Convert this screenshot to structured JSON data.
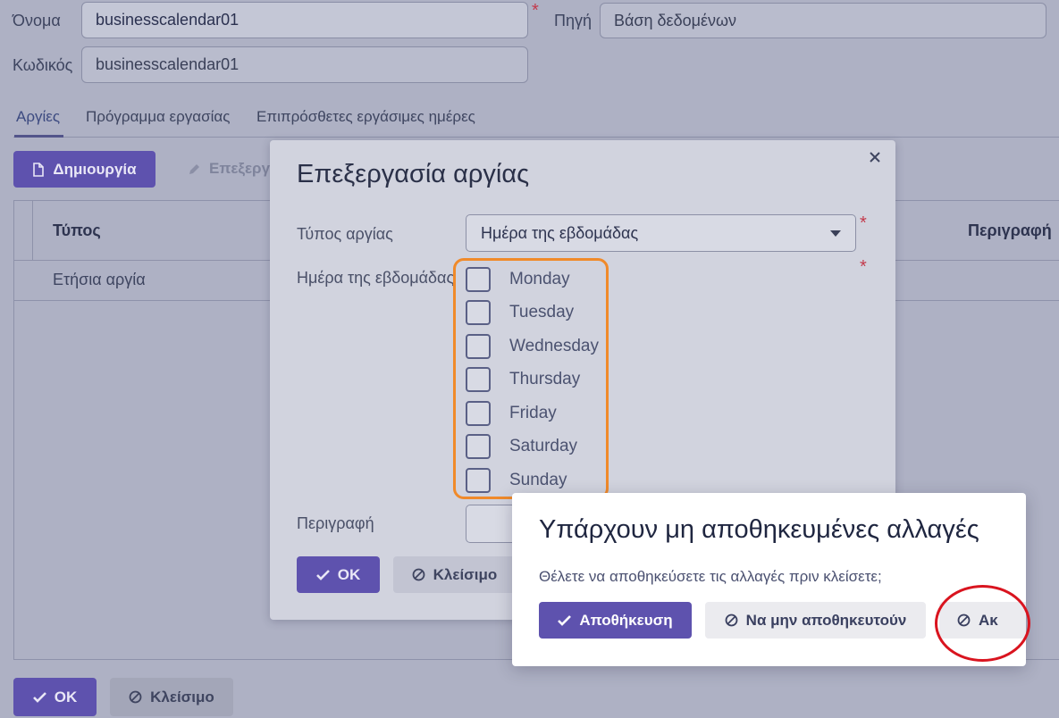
{
  "form": {
    "name_label": "Όνομα",
    "name_value": "businesscalendar01",
    "source_label": "Πηγή",
    "source_value": "Βάση δεδομένων",
    "code_label": "Κωδικός",
    "code_value": "businesscalendar01",
    "required_mark": "*"
  },
  "tabs": [
    {
      "label": "Αργίες"
    },
    {
      "label": "Πρόγραμμα εργασίας"
    },
    {
      "label": "Επιπρόσθετες εργάσιμες ημέρες"
    }
  ],
  "toolbar": {
    "create_label": "Δημιουργία",
    "edit_label": "Επεξεργ"
  },
  "table": {
    "col_type": "Τύπος",
    "col_description": "Περιγραφή",
    "rows": [
      {
        "type": "Ετήσια αργία"
      }
    ]
  },
  "footer": {
    "ok_label": "OK",
    "close_label": "Κλείσιμο"
  },
  "dialog": {
    "title": "Επεξεργασία αργίας",
    "holiday_type_label": "Τύπος αργίας",
    "holiday_type_value": "Ημέρα της εβδομάδας",
    "weekday_label": "Ημέρα της εβδομάδας",
    "weekdays": [
      {
        "label": "Monday",
        "checked": false
      },
      {
        "label": "Tuesday",
        "checked": false
      },
      {
        "label": "Wednesday",
        "checked": false
      },
      {
        "label": "Thursday",
        "checked": false
      },
      {
        "label": "Friday",
        "checked": false
      },
      {
        "label": "Saturday",
        "checked": false
      },
      {
        "label": "Sunday",
        "checked": false
      }
    ],
    "description_label": "Περιγραφή",
    "ok_label": "OK",
    "close_label": "Κλείσιμο"
  },
  "confirm": {
    "title": "Υπάρχουν μη αποθηκευμένες αλλαγές",
    "message": "Θέλετε να αποθηκεύσετε τις αλλαγές πριν κλείσετε;",
    "save_label": "Αποθήκευση",
    "dont_save_label": "Να μην αποθηκευτούν",
    "cancel_label": "Ακ"
  },
  "annotations": {
    "orange_highlight_color": "#f08a2a",
    "red_circle_color": "#d9141f"
  }
}
